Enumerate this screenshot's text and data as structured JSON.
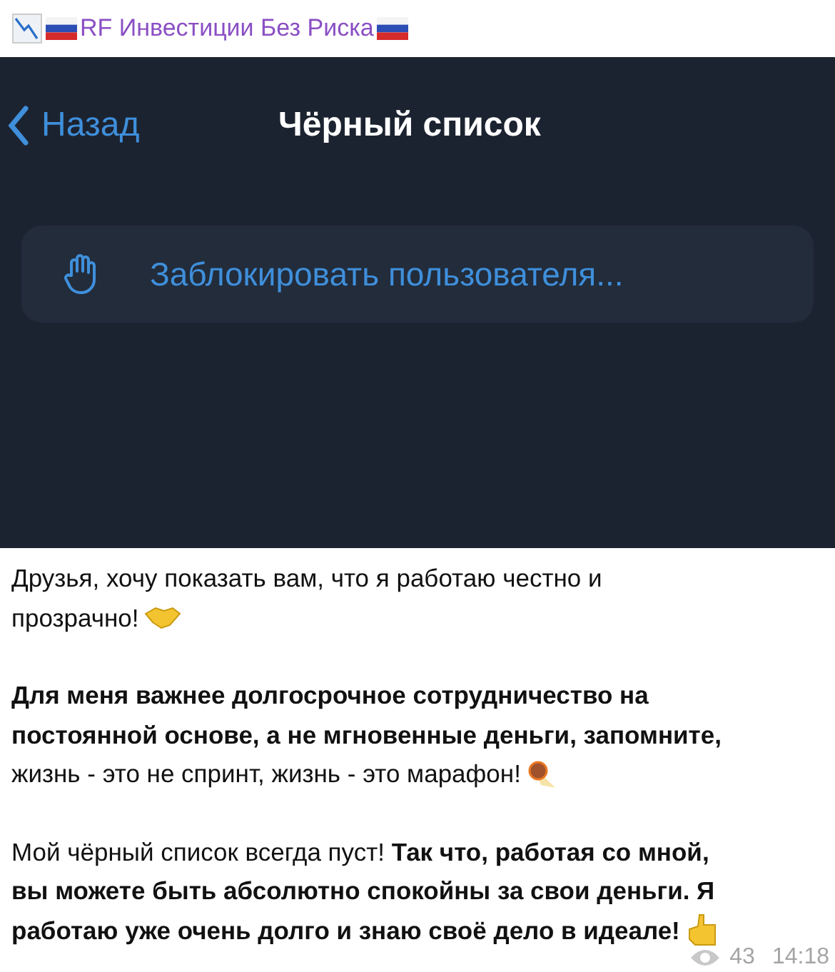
{
  "channel": {
    "title": "RF Инвестиции Без Риска"
  },
  "screenshot": {
    "back": "Назад",
    "title": "Чёрный список",
    "action": "Заблокировать пользователя..."
  },
  "paragraphs": [
    {
      "lines": [
        "Друзья, хочу показать вам, что я работаю честно и",
        "прозрачно!"
      ]
    },
    {
      "lines": [
        "**Для меня важнее долгосрочное сотрудничество на**",
        "**постоянной основе, а не мгновенные деньги, запомните,**",
        "жизнь - это не спринт, жизнь - это марафон!"
      ]
    },
    {
      "lines": [
        "Мой чёрный список всегда пуст! **Так что, работая со мной,**",
        "**вы можете быть абсолютно спокойны за свои деньги. Я**",
        "**работаю уже очень долго и знаю своё дело в идеале!**"
      ]
    }
  ],
  "footer": {
    "views": "43",
    "time": "14:18"
  }
}
